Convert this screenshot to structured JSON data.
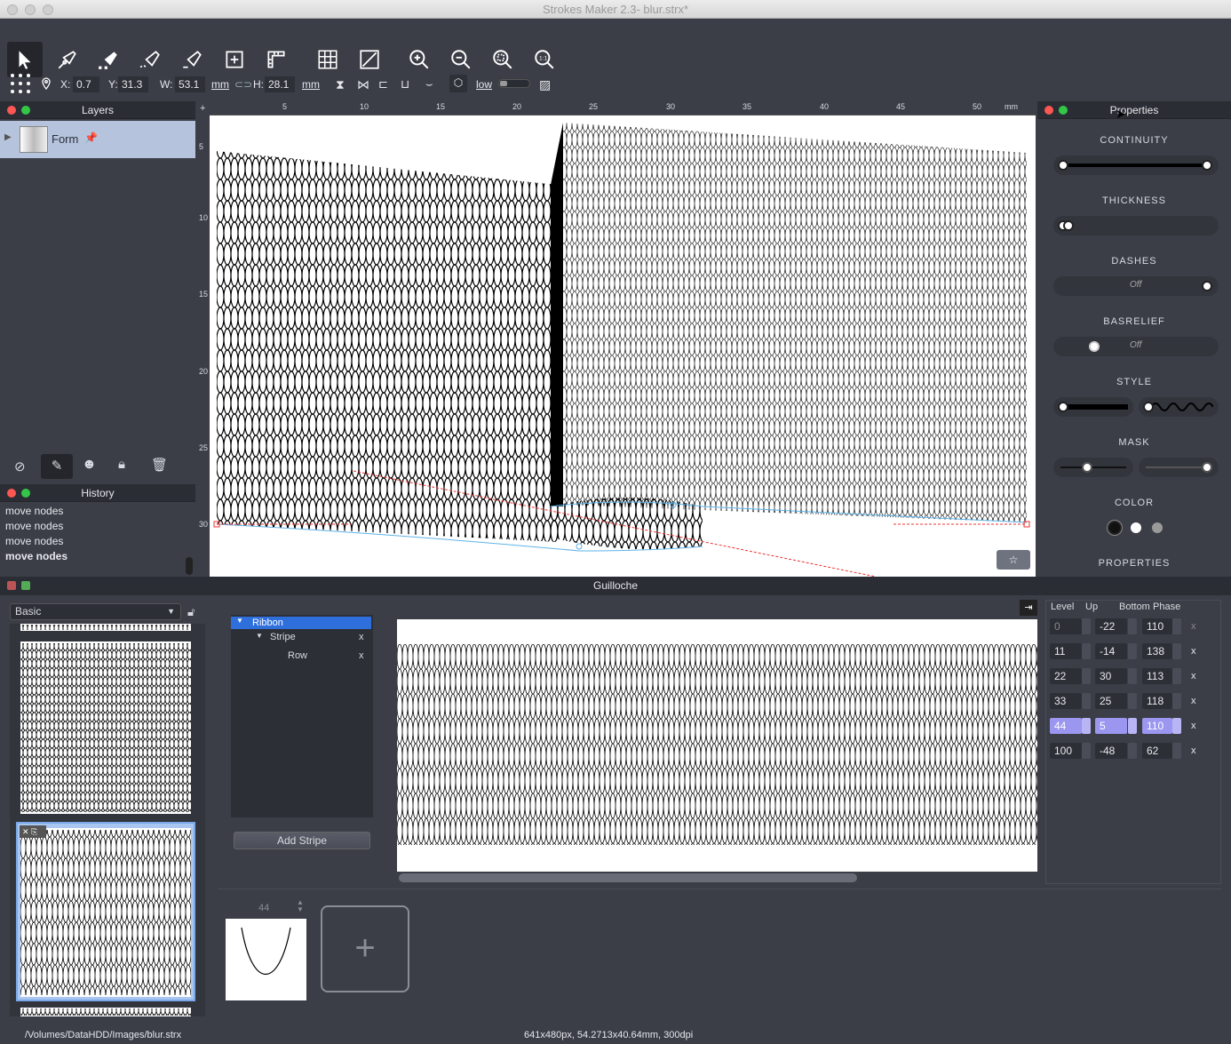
{
  "window": {
    "title": "Strokes Maker 2.3- blur.strx*"
  },
  "toolbar": {
    "tools": [
      "select-tool",
      "pen-tool",
      "node-pen-tool",
      "smooth-tool",
      "eraser-tool",
      "frame-tool",
      "ruler-tool",
      "grid-tool",
      "transform-tool",
      "zoom-in-tool",
      "zoom-out-tool",
      "zoom-fit-tool",
      "zoom-actual-tool"
    ],
    "x_label": "X:",
    "x_value": "0.7",
    "y_label": "Y:",
    "y_value": "31.3",
    "w_label": "W:",
    "w_value": "53.1",
    "w_unit": "mm",
    "h_label": "H:",
    "h_value": "28.1",
    "h_unit": "mm",
    "quality": "low"
  },
  "layers": {
    "title": "Layers",
    "items": [
      {
        "name": "Form"
      }
    ]
  },
  "ruler": {
    "top_ticks": [
      "5",
      "10",
      "15",
      "20",
      "25",
      "30",
      "35",
      "40",
      "45",
      "50",
      "mm"
    ],
    "left_ticks": [
      "5",
      "10",
      "15",
      "20",
      "25",
      "30"
    ]
  },
  "properties": {
    "title": "Properties",
    "sections": [
      "CONTINUITY",
      "THICKNESS",
      "DASHES",
      "BASRELIEF",
      "STYLE",
      "MASK",
      "COLOR",
      "PROPERTIES"
    ],
    "dashes_state": "Off",
    "basrelief_state": "Off",
    "colors": [
      "#111111",
      "#ffffff",
      "#9a9a9a"
    ]
  },
  "history": {
    "title": "History",
    "items": [
      "move nodes",
      "move nodes",
      "move nodes",
      "move nodes"
    ]
  },
  "guilloche": {
    "title": "Guilloche",
    "preset": "Basic",
    "tree": {
      "root": "Ribbon",
      "child": "Stripe",
      "grandchild": "Row",
      "remove": "x"
    },
    "add_stripe": "Add Stripe",
    "curve_index": "44",
    "add_curve": "+",
    "table": {
      "headers": [
        "Level",
        "Up",
        "Bottom",
        "Phase"
      ],
      "rows": [
        {
          "level": "0",
          "up": "-22",
          "phase": "110",
          "x": "x"
        },
        {
          "level": "11",
          "up": "-14",
          "phase": "138",
          "x": "x"
        },
        {
          "level": "22",
          "up": "30",
          "phase": "113",
          "x": "x"
        },
        {
          "level": "33",
          "up": "25",
          "phase": "118",
          "x": "x"
        },
        {
          "level": "44",
          "up": "5",
          "phase": "110",
          "x": "x"
        },
        {
          "level": "100",
          "up": "-48",
          "phase": "62",
          "x": "x"
        }
      ]
    }
  },
  "status": {
    "path": "/Volumes/DataHDD/Images/blur.strx",
    "info": "641x480px, 54.2713x40.64mm, 300dpi"
  }
}
